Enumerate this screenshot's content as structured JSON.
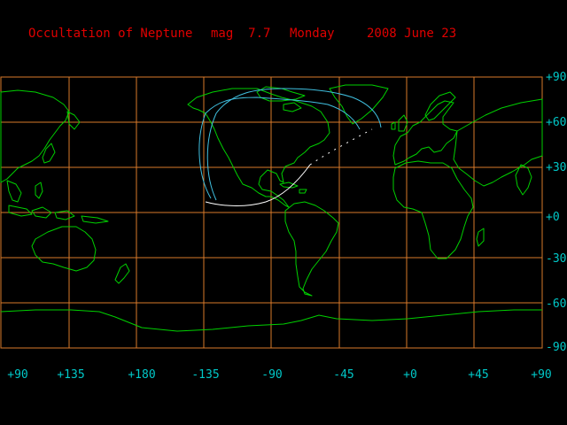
{
  "header": {
    "event": "Occultation of Neptune",
    "magnitude": "mag  7.7",
    "weekday": "Monday",
    "date": "2008 June 23"
  },
  "map": {
    "grid_color": "#d97a2a",
    "coast_color": "#00d000",
    "track_daylight_color": "#ffffff",
    "track_limit_color": "#40c0e0",
    "lat_labels": [
      "+90",
      "+60",
      "+30",
      "+0",
      "-30",
      "-60",
      "-90"
    ],
    "lon_labels": [
      "+90",
      "+135",
      "+180",
      "-135",
      "-90",
      "-45",
      "+0",
      "+45",
      "+90"
    ]
  }
}
